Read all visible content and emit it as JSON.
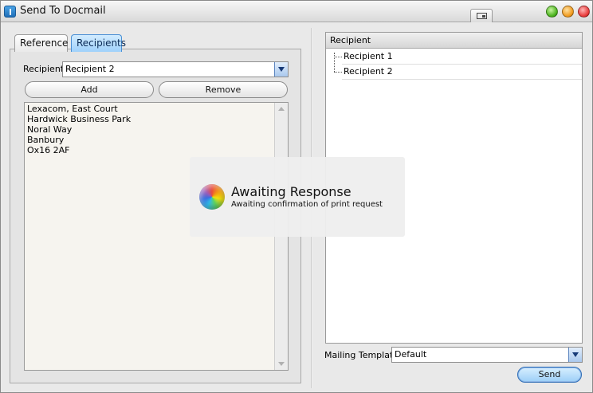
{
  "window": {
    "title": "Send To Docmail"
  },
  "tabs": [
    {
      "label": "Reference"
    },
    {
      "label": "Recipients"
    }
  ],
  "recipient_field": {
    "label": "Recipient",
    "value": "Recipient 2"
  },
  "buttons": {
    "add": "Add",
    "remove": "Remove",
    "send": "Send"
  },
  "address_lines": [
    "Lexacom, East Court",
    "Hardwick Business Park",
    "Noral Way",
    "Banbury",
    "Ox16 2AF"
  ],
  "recipients_tree": {
    "header": "Recipient",
    "items": [
      "Recipient 1",
      "Recipient 2"
    ]
  },
  "mailing_template": {
    "label": "Mailing Template",
    "value": "Default"
  },
  "notification": {
    "title": "Awaiting Response",
    "message": "Awaiting confirmation of print request"
  },
  "colors": {
    "active_tab": "#9fd1fb",
    "send_button": "#9ccff7"
  }
}
